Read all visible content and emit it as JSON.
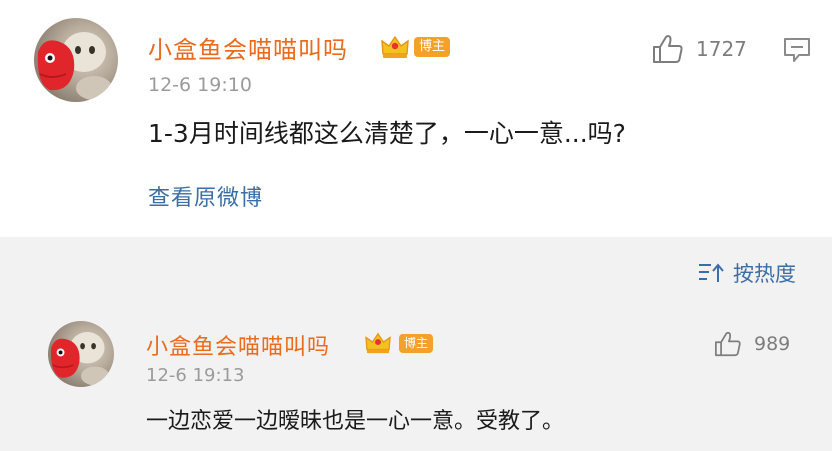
{
  "main_comment": {
    "username": "小盒鱼会喵喵叫吗",
    "badge": "博主",
    "timestamp": "12-6 19:10",
    "text": "1-3月时间线都这么清楚了，一心一意...吗?",
    "view_original": "查看原微博",
    "likes": "1727"
  },
  "replies_section": {
    "sort_label": "按热度",
    "items": [
      {
        "username": "小盒鱼会喵喵叫吗",
        "badge": "博主",
        "timestamp": "12-6 19:13",
        "text": "一边恋爱一边暧昧也是一心一意。受教了。",
        "likes": "989"
      }
    ]
  },
  "icons": {
    "crown": "crown-icon",
    "like": "thumbs-up-icon",
    "more": "comment-menu-icon",
    "sort": "sort-icon"
  },
  "colors": {
    "username": "#e86b1e",
    "badge": "#f4a12a",
    "link": "#3a6ea5",
    "reply_background": "#f2f2f2",
    "muted": "#9b9b9b"
  }
}
